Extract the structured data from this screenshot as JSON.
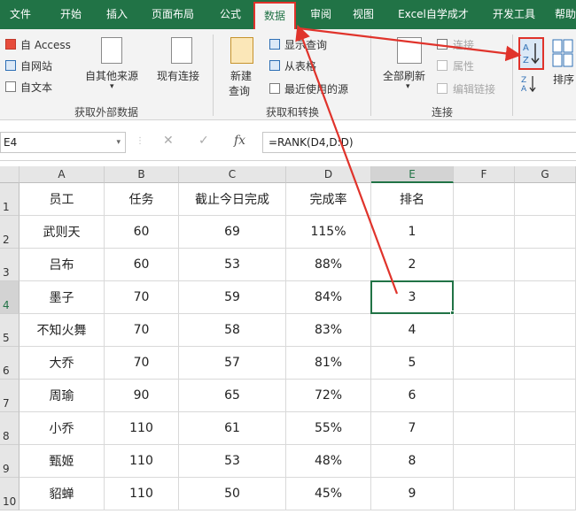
{
  "ribbon_tabs": [
    "文件",
    "开始",
    "插入",
    "页面布局",
    "公式",
    "数据",
    "审阅",
    "视图",
    "Excel自学成才",
    "开发工具",
    "帮助"
  ],
  "active_tab": "数据",
  "ribbon": {
    "external": {
      "from_access": "自 Access",
      "from_web": "自网站",
      "from_text": "自文本",
      "from_other": "自其他来源",
      "existing": "现有连接",
      "label": "获取外部数据"
    },
    "transform": {
      "new_query_line1": "新建",
      "new_query_line2": "查询",
      "show_query": "显示查询",
      "from_table": "从表格",
      "recent_sources": "最近使用的源",
      "label": "获取和转换"
    },
    "connections": {
      "refresh_all": "全部刷新",
      "connections": "连接",
      "properties": "属性",
      "edit_links": "编辑链接",
      "label": "连接"
    },
    "sort": {
      "sort_label": "排序"
    }
  },
  "formula_bar": {
    "name_box": "E4",
    "formula": "=RANK(D4,D:D)"
  },
  "columns": [
    "A",
    "B",
    "C",
    "D",
    "E",
    "F",
    "G"
  ],
  "rows": [
    [
      "员工",
      "任务",
      "截止今日完成",
      "完成率",
      "排名"
    ],
    [
      "武则天",
      "60",
      "69",
      "115%",
      "1"
    ],
    [
      "吕布",
      "60",
      "53",
      "88%",
      "2"
    ],
    [
      "墨子",
      "70",
      "59",
      "84%",
      "3"
    ],
    [
      "不知火舞",
      "70",
      "58",
      "83%",
      "4"
    ],
    [
      "大乔",
      "70",
      "57",
      "81%",
      "5"
    ],
    [
      "周瑜",
      "90",
      "65",
      "72%",
      "6"
    ],
    [
      "小乔",
      "110",
      "61",
      "55%",
      "7"
    ],
    [
      "甄姬",
      "110",
      "53",
      "48%",
      "8"
    ],
    [
      "貂蝉",
      "110",
      "50",
      "45%",
      "9"
    ]
  ],
  "row_numbers": [
    "1",
    "2",
    "3",
    "4",
    "5",
    "6",
    "7",
    "8",
    "9",
    "10"
  ],
  "colors": {
    "excel_green": "#217346",
    "highlight_red": "#e0332b",
    "ribbon_bg": "#f3f3f3"
  }
}
